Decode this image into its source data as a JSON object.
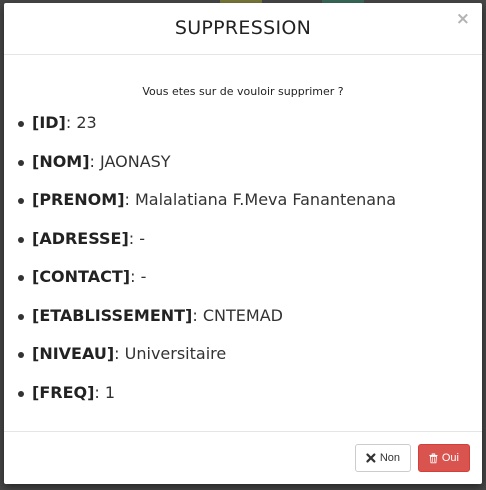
{
  "colors": {
    "danger": "#d9534f",
    "backdrop": "#474747"
  },
  "modal": {
    "title": "SUPPRESSION",
    "close_glyph": "×",
    "question": "Vous etes sur de vouloir supprimer ?",
    "fields": [
      {
        "key": "[ID]",
        "sep": ": ",
        "value": "23"
      },
      {
        "key": "[NOM]",
        "sep": ": ",
        "value": "JAONASY"
      },
      {
        "key": "[PRENOM]",
        "sep": ": ",
        "value": "Malalatiana F.Meva Fanantenana"
      },
      {
        "key": "[ADRESSE]",
        "sep": ": ",
        "value": "-"
      },
      {
        "key": "[CONTACT]",
        "sep": ": ",
        "value": "-"
      },
      {
        "key": "[ETABLISSEMENT]",
        "sep": ": ",
        "value": "CNTEMAD"
      },
      {
        "key": "[NIVEAU]",
        "sep": ": ",
        "value": "Universitaire"
      },
      {
        "key": "[FREQ]",
        "sep": ": ",
        "value": "1"
      }
    ],
    "buttons": {
      "no_label": "Non",
      "no_icon": "times-icon",
      "yes_label": "Oui",
      "yes_icon": "trash-icon"
    }
  }
}
